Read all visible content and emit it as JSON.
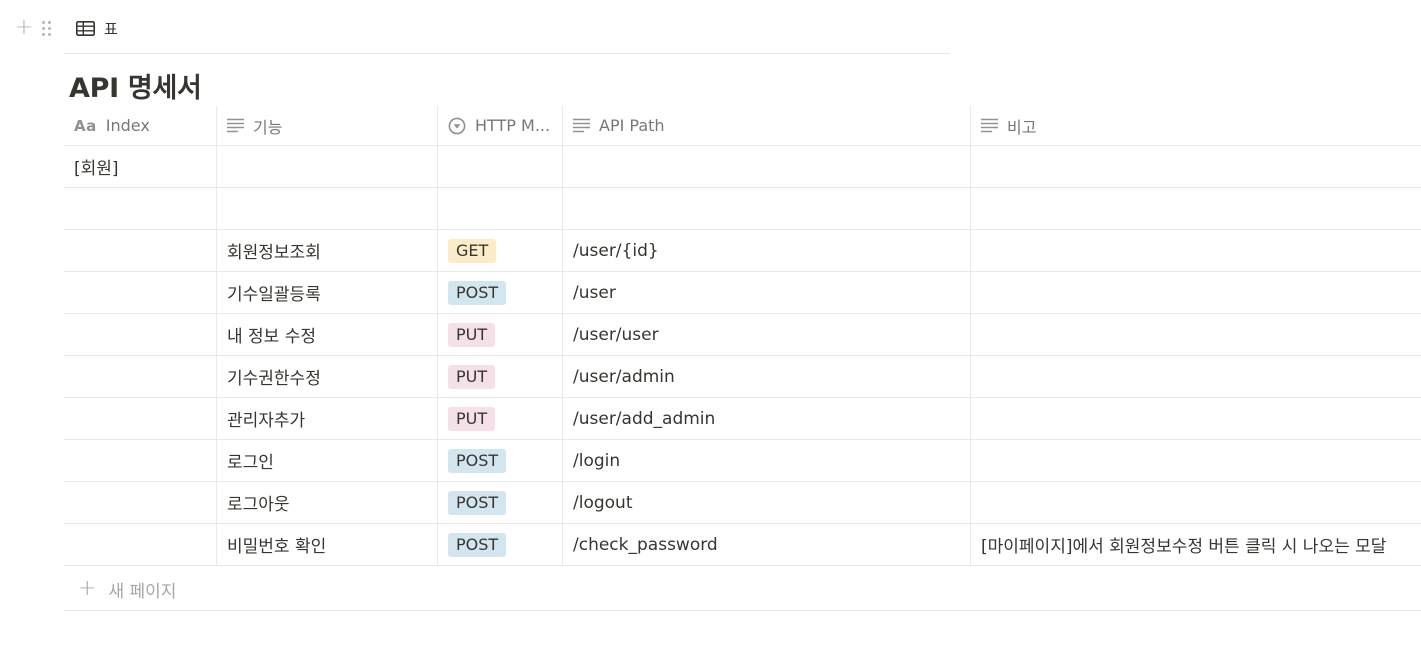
{
  "view": {
    "tab_label": "표",
    "tab_icon": "table-icon"
  },
  "database": {
    "title": "API 명세서"
  },
  "columns": [
    {
      "label": "Index",
      "icon": "title-aa-icon"
    },
    {
      "label": "기능",
      "icon": "text-lines-icon"
    },
    {
      "label": "HTTP M...",
      "icon": "select-icon"
    },
    {
      "label": "API Path",
      "icon": "text-lines-icon"
    },
    {
      "label": "비고",
      "icon": "text-lines-icon"
    }
  ],
  "rows": [
    {
      "index": "[회원]",
      "feature": "",
      "method": "",
      "path": "",
      "note": ""
    },
    {
      "index": "",
      "feature": "",
      "method": "",
      "path": "",
      "note": ""
    },
    {
      "index": "",
      "feature": "회원정보조회",
      "method": "GET",
      "path": "/user/{id}",
      "note": ""
    },
    {
      "index": "",
      "feature": "기수일괄등록",
      "method": "POST",
      "path": "/user",
      "note": ""
    },
    {
      "index": "",
      "feature": "내 정보 수정",
      "method": "PUT",
      "path": "/user/user",
      "note": ""
    },
    {
      "index": "",
      "feature": "기수권한수정",
      "method": "PUT",
      "path": "/user/admin",
      "note": ""
    },
    {
      "index": "",
      "feature": "관리자추가",
      "method": "PUT",
      "path": "/user/add_admin",
      "note": ""
    },
    {
      "index": "",
      "feature": "로그인",
      "method": "POST",
      "path": "/login",
      "note": ""
    },
    {
      "index": "",
      "feature": "로그아웃",
      "method": "POST",
      "path": "/logout",
      "note": ""
    },
    {
      "index": "",
      "feature": "비밀번호 확인",
      "method": "POST",
      "path": "/check_password",
      "note": "[마이페이지]에서 회원정보수정 버튼 클릭 시 나오는 모달"
    }
  ],
  "method_colors": {
    "GET": "#fbecc9",
    "POST": "#d3e5ef",
    "PUT": "#f5e0e9"
  },
  "new_page_label": "새 페이지"
}
